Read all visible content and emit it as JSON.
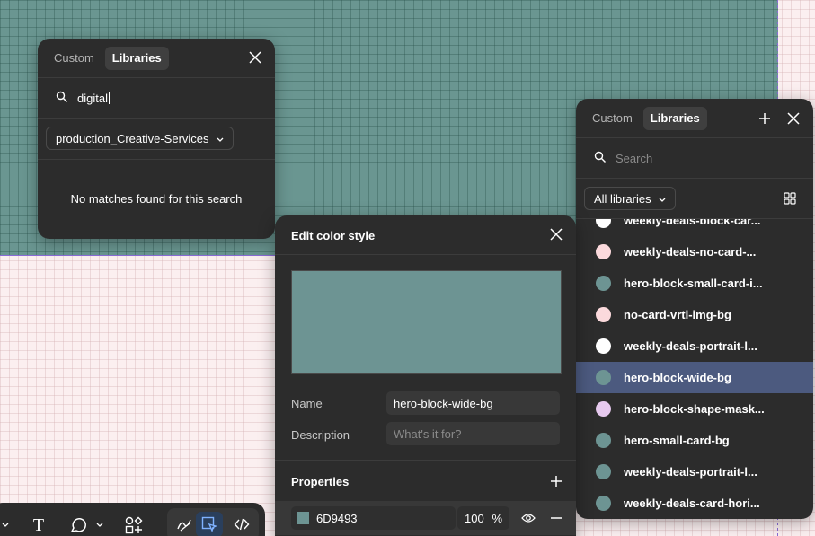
{
  "library_panel_left": {
    "tabs": [
      "Custom",
      "Libraries"
    ],
    "active_tab": "Libraries",
    "search_value": "digital",
    "library_filter": "production_Creative-Services",
    "empty_message": "No matches found for this search"
  },
  "library_panel_right": {
    "tabs": [
      "Custom",
      "Libraries"
    ],
    "active_tab": "Libraries",
    "search_placeholder": "Search",
    "library_filter": "All libraries",
    "items": [
      {
        "label": "weekly-deals-block-car...",
        "color": "#ffffff"
      },
      {
        "label": "weekly-deals-no-card-...",
        "color": "#fbd9dc"
      },
      {
        "label": "hero-block-small-card-i...",
        "color": "#6d9493"
      },
      {
        "label": "no-card-vrtl-img-bg",
        "color": "#fbd9dc"
      },
      {
        "label": "weekly-deals-portrait-l...",
        "color": "#ffffff"
      },
      {
        "label": "hero-block-wide-bg",
        "color": "#6d9493",
        "selected": true
      },
      {
        "label": "hero-block-shape-mask...",
        "color": "#e6c9ee"
      },
      {
        "label": "hero-small-card-bg",
        "color": "#6d9493"
      },
      {
        "label": "weekly-deals-portrait-l...",
        "color": "#6d9493"
      },
      {
        "label": "weekly-deals-card-hori...",
        "color": "#6d9493"
      }
    ]
  },
  "edit_color_style": {
    "title": "Edit color style",
    "preview_color": "#6D9493",
    "name_label": "Name",
    "name_value": "hero-block-wide-bg",
    "description_label": "Description",
    "description_placeholder": "What's it for?",
    "properties_label": "Properties",
    "hex_value": "6D9493",
    "opacity_value": "100",
    "opacity_unit": "%"
  },
  "toolbar": {
    "tools": [
      "text-tool-icon",
      "shape-tool-icon",
      "components-tool-icon",
      "draw-tool-icon",
      "design-mode-icon",
      "dev-mode-icon"
    ],
    "text_tool_glyph": "T"
  },
  "colors": {
    "canvas_frame": "#6a9691",
    "canvas_background": "#fbeff0",
    "panel_background": "#2c2c2c",
    "selection": "#4c5a7f"
  }
}
